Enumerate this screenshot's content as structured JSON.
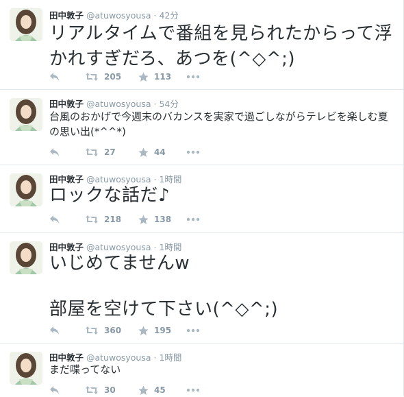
{
  "tweets": [
    {
      "name": "田中敦子",
      "handle": "@atuwosyousa",
      "time": "42分",
      "text": "リアルタイムで番組を見られたからって浮かれすぎだろ、あつを(^◇^;)",
      "text_lines": [],
      "retweets": "205",
      "favorites": "113"
    },
    {
      "name": "田中敦子",
      "handle": "@atuwosyousa",
      "time": "54分",
      "text": "台風のおかげで今週末のバカンスを実家で過ごしながらテレビを楽しむ夏の思い出(*^^*)",
      "text_lines": [],
      "retweets": "27",
      "favorites": "44"
    },
    {
      "name": "田中敦子",
      "handle": "@atuwosyousa",
      "time": "1時間",
      "text": "ロックな話だ♪",
      "text_lines": [],
      "retweets": "218",
      "favorites": "138"
    },
    {
      "name": "田中敦子",
      "handle": "@atuwosyousa",
      "time": "1時間",
      "text": "",
      "text_lines": [
        "いじめてませんw",
        "",
        "部屋を空けて下さい(^◇^;)"
      ],
      "retweets": "360",
      "favorites": "195"
    },
    {
      "name": "田中敦子",
      "handle": "@atuwosyousa",
      "time": "1時間",
      "text": "まだ喋ってない",
      "text_lines": [],
      "retweets": "30",
      "favorites": "45"
    }
  ],
  "icons": {
    "reply": "reply-icon",
    "retweet": "retweet-icon",
    "favorite": "star-icon",
    "more": "more-dots-icon"
  },
  "colors": {
    "text": "#292f33",
    "muted": "#8899a6",
    "icon": "#aab8c2",
    "border": "#e1e8ed"
  }
}
